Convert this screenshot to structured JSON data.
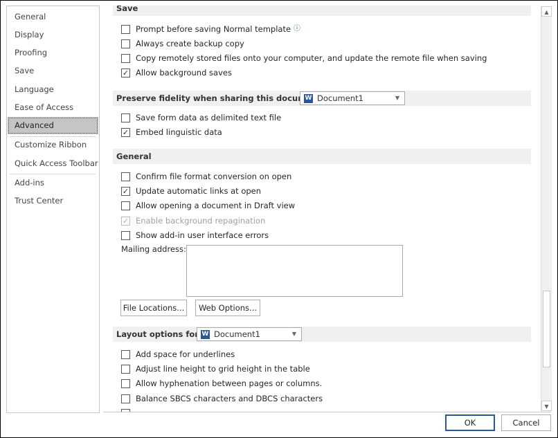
{
  "sidebar": {
    "items": [
      {
        "label": "General"
      },
      {
        "label": "Display"
      },
      {
        "label": "Proofing"
      },
      {
        "label": "Save"
      },
      {
        "label": "Language"
      },
      {
        "label": "Ease of Access"
      },
      {
        "label": "Advanced",
        "selected": true
      },
      {
        "label": "Customize Ribbon"
      },
      {
        "label": "Quick Access Toolbar"
      },
      {
        "label": "Add-ins"
      },
      {
        "label": "Trust Center"
      }
    ]
  },
  "save": {
    "title": "Save",
    "options": [
      {
        "label": "Prompt before saving Normal template",
        "checked": false,
        "info_icon": "info-circle-icon"
      },
      {
        "label": "Always create backup copy",
        "checked": false
      },
      {
        "label": "Copy remotely stored files onto your computer, and update the remote file when saving",
        "checked": false
      },
      {
        "label": "Allow background saves",
        "checked": true
      }
    ]
  },
  "fidelity": {
    "title": "Preserve fidelity when sharing this document:",
    "document": "Document1",
    "options": [
      {
        "label": "Save form data as delimited text file",
        "checked": false
      },
      {
        "label": "Embed linguistic data",
        "checked": true
      }
    ]
  },
  "general": {
    "title": "General",
    "options": [
      {
        "label": "Confirm file format conversion on open",
        "checked": false
      },
      {
        "label": "Update automatic links at open",
        "checked": true
      },
      {
        "label": "Allow opening a document in Draft view",
        "checked": false
      },
      {
        "label": "Enable background repagination",
        "checked": true,
        "disabled": true
      },
      {
        "label": "Show add-in user interface errors",
        "checked": false
      }
    ],
    "mailing_label": "Mailing address:",
    "mailing_value": "",
    "file_locations": "File Locations...",
    "web_options": "Web Options..."
  },
  "layout": {
    "title": "Layout options for:",
    "document": "Document1",
    "options": [
      {
        "label": "Add space for underlines",
        "checked": false
      },
      {
        "label": "Adjust line height to grid height in the table",
        "checked": false
      },
      {
        "label": "Allow hyphenation between pages or columns.",
        "checked": false
      },
      {
        "label": "Balance SBCS characters and DBCS characters",
        "checked": false
      }
    ]
  },
  "footer": {
    "ok": "OK",
    "cancel": "Cancel"
  },
  "colors": {
    "accent": "#2b579a",
    "selected": "#c5c5c5",
    "header_bg": "#f0f0f0"
  }
}
